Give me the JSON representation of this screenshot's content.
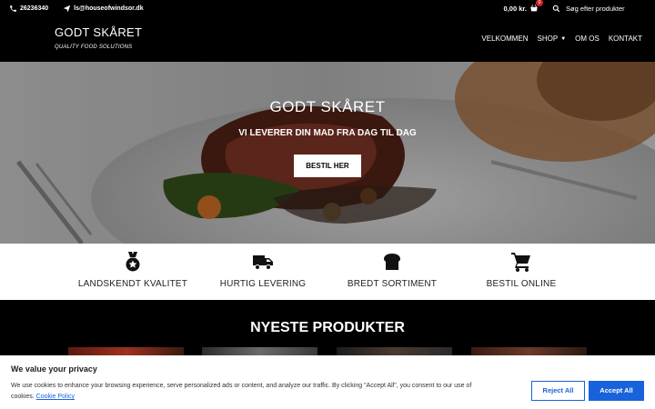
{
  "topbar": {
    "phone": "26236340",
    "email": "ls@houseofwindsor.dk",
    "cart_total": "0,00 kr.",
    "cart_count": "0",
    "search_placeholder": "Søg efter produkter"
  },
  "header": {
    "logo_title": "GODT SKÅRET",
    "logo_tagline": "QUALITY FOOD SOLUTIONS",
    "nav": [
      "VELKOMMEN",
      "SHOP",
      "OM OS",
      "KONTAKT"
    ]
  },
  "hero": {
    "title": "GODT SKÅRET",
    "subtitle": "VI LEVERER DIN MAD FRA DAG TIL DAG",
    "button": "BESTIL HER"
  },
  "features": [
    {
      "icon": "medal-icon",
      "label": "LANDSKENDT KVALITET"
    },
    {
      "icon": "truck-icon",
      "label": "HURTIG LEVERING"
    },
    {
      "icon": "bread-icon",
      "label": "BREDT SORTIMENT"
    },
    {
      "icon": "shopping-cart-icon",
      "label": "BESTIL ONLINE"
    }
  ],
  "products": {
    "title": "NYESTE PRODUKTER"
  },
  "cookie": {
    "title": "We value your privacy",
    "text": "We use cookies to enhance your browsing experience, serve personalized ads or content, and analyze our traffic. By clicking \"Accept All\", you consent to our use of cookies.",
    "link": "Cookie Policy",
    "reject": "Reject All",
    "accept": "Accept All"
  },
  "colors": {
    "accent": "#1863dc",
    "badge": "#d2232a"
  }
}
